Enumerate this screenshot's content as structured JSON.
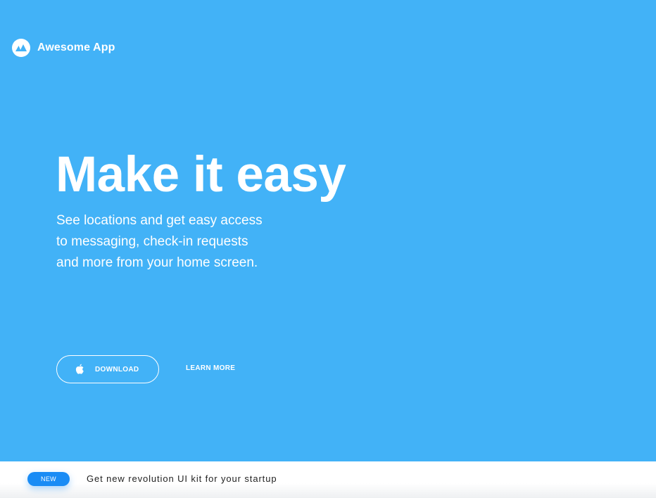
{
  "brand": {
    "name": "Awesome App",
    "logo_icon": "mountain-icon"
  },
  "hero": {
    "background_color": "#42b2f7",
    "headline": "Make it easy",
    "subtitle_lines": [
      "See locations and get easy access",
      "to messaging, check-in requests",
      "and more from your home screen."
    ]
  },
  "actions": {
    "download_label": "DOWNLOAD",
    "download_icon": "apple-icon",
    "learn_more_label": "LEARN MORE"
  },
  "promo": {
    "badge": "NEW",
    "badge_color": "#1a8cf5",
    "text": "Get new revolution UI kit for your startup"
  }
}
